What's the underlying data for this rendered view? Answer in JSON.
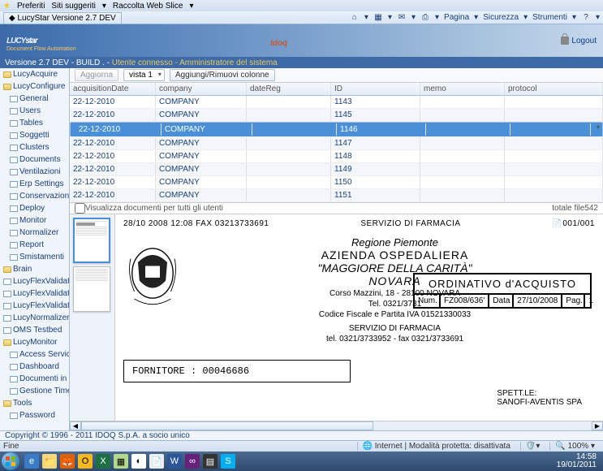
{
  "ie": {
    "favorites": "Preferiti",
    "suggested": "Siti suggeriti",
    "webslice": "Raccolta Web Slice",
    "tab_title": "LucyStar Versione 2.7 DEV",
    "menu": {
      "page": "Pagina",
      "safety": "Sicurezza",
      "tools": "Strumenti"
    },
    "status_left": "Fine",
    "status_right": "Internet | Modalità protetta: disattivata",
    "zoom": "100%"
  },
  "app": {
    "logo": "LUCYstar",
    "logo_sub": "Document Flow Automation",
    "logout": "Logout",
    "version_line": "Versione 2.7 DEV - BUILD . -",
    "user_line": "Utente connesso - Amministratore del sistema",
    "copyright": "Copyright © 1996 - 2011 IDOQ S.p.A. a socio unico"
  },
  "tree": [
    {
      "label": "LucyAcquire",
      "icon": "folder",
      "indent": 0
    },
    {
      "label": "LucyConfigure",
      "icon": "folder",
      "indent": 0
    },
    {
      "label": "General",
      "icon": "doc",
      "indent": 1
    },
    {
      "label": "Users",
      "icon": "doc",
      "indent": 1
    },
    {
      "label": "Tables",
      "icon": "doc",
      "indent": 1
    },
    {
      "label": "Soggetti",
      "icon": "doc",
      "indent": 1
    },
    {
      "label": "Clusters",
      "icon": "doc",
      "indent": 1
    },
    {
      "label": "Documents",
      "icon": "doc",
      "indent": 1
    },
    {
      "label": "Ventilazioni",
      "icon": "doc",
      "indent": 1
    },
    {
      "label": "Erp Settings",
      "icon": "doc",
      "indent": 1
    },
    {
      "label": "Conservazione",
      "icon": "doc",
      "indent": 1
    },
    {
      "label": "Deploy",
      "icon": "doc",
      "indent": 1
    },
    {
      "label": "Monitor",
      "icon": "doc",
      "indent": 1
    },
    {
      "label": "Normalizer",
      "icon": "doc",
      "indent": 1
    },
    {
      "label": "Report",
      "icon": "doc",
      "indent": 1
    },
    {
      "label": "Smistamenti",
      "icon": "doc",
      "indent": 1
    },
    {
      "label": "Brain",
      "icon": "folder",
      "indent": 0
    },
    {
      "label": "LucyFlexValidationEst",
      "icon": "doc",
      "indent": 0
    },
    {
      "label": "LucyFlexValidationLorenzo",
      "icon": "doc",
      "indent": 0
    },
    {
      "label": "LucyFlexValidationMario",
      "icon": "doc",
      "indent": 0
    },
    {
      "label": "LucyNormalizer",
      "icon": "doc",
      "indent": 0
    },
    {
      "label": "OMS Testbed",
      "icon": "doc",
      "indent": 0
    },
    {
      "label": "LucyMonitor",
      "icon": "folder",
      "indent": 0
    },
    {
      "label": "Access Service",
      "icon": "doc",
      "indent": 1
    },
    {
      "label": "Dashboard",
      "icon": "doc",
      "indent": 1
    },
    {
      "label": "Documenti in errore",
      "icon": "doc",
      "indent": 1
    },
    {
      "label": "Gestione Timer",
      "icon": "doc",
      "indent": 1
    },
    {
      "label": "Tools",
      "icon": "folder",
      "indent": 0
    },
    {
      "label": "Password",
      "icon": "doc",
      "indent": 1
    }
  ],
  "toolbar": {
    "refresh": "Aggiorna",
    "view": "vista 1",
    "columns": "Aggiungi/Rimuovi colonne"
  },
  "grid": {
    "headers": {
      "date": "acquisitionDate",
      "company": "company",
      "dateReg": "dateReg",
      "id": "ID",
      "memo": "memo",
      "protocol": "protocol"
    },
    "rows": [
      {
        "date": "22-12-2010",
        "company": "COMPANY",
        "id": "1143"
      },
      {
        "date": "22-12-2010",
        "company": "COMPANY",
        "id": "1145"
      },
      {
        "date": "22-12-2010",
        "company": "COMPANY",
        "id": "1146"
      },
      {
        "date": "22-12-2010",
        "company": "COMPANY",
        "id": "1147"
      },
      {
        "date": "22-12-2010",
        "company": "COMPANY",
        "id": "1148"
      },
      {
        "date": "22-12-2010",
        "company": "COMPANY",
        "id": "1149"
      },
      {
        "date": "22-12-2010",
        "company": "COMPANY",
        "id": "1150"
      },
      {
        "date": "22-12-2010",
        "company": "COMPANY",
        "id": "1151"
      }
    ],
    "footer_check": "Visualizza documenti per tutti gli utenti",
    "footer_total": "totale file542"
  },
  "doc": {
    "fax_left": "28/10 2008 12:08 FAX 03213733691",
    "fax_center": "SERVIZIO DI FARMACIA",
    "fax_right": "001/001",
    "region": "Regione Piemonte",
    "az1": "AZIENDA OSPEDALIERA",
    "az2": "\"MAGGIORE DELLA CARITÀ\"",
    "city": "NOVARA",
    "addr": "Corso Mazzini, 18 - 28100 NOVARA",
    "tel1": "Tel. 0321/3731",
    "cf": "Codice Fiscale e Partita IVA 01521330033",
    "serv": "SERVIZIO DI FARMACIA",
    "tel2": "tel. 0321/3733952 - fax 0321/3733691",
    "order_title": "ORDINATIVO d'ACQUISTO",
    "order_num_lbl": "Num.",
    "order_num": "FZ008/636'",
    "order_date_lbl": "Data",
    "order_date": "27/10/2008",
    "order_pg_lbl": "Pag.",
    "order_pg": "1",
    "forn": "FORNITORE : 00046686",
    "spett1": "SPETT.LE:",
    "spett2": "SANOFI-AVENTIS SPA"
  },
  "tray": {
    "time": "14:58",
    "date": "19/01/2011"
  }
}
